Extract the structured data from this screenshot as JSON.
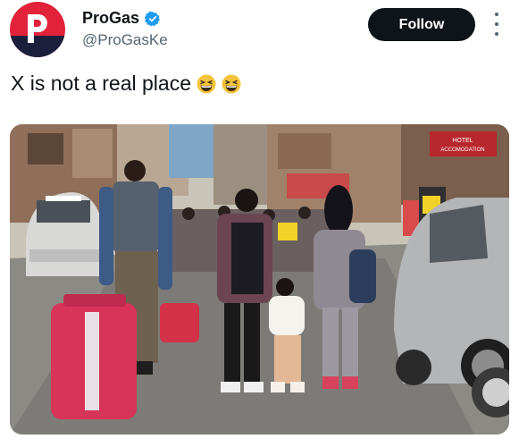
{
  "tweet": {
    "author": {
      "display_name": "ProGas",
      "handle": "@ProGasKe",
      "avatar_letter": "P",
      "verified": true,
      "brand_colors": {
        "red": "#e2223a",
        "navy": "#1c1f3b",
        "verified_blue": "#1d9bf0"
      }
    },
    "follow_label": "Follow",
    "text": "X is not a real place",
    "emojis": [
      "grinning-squinting-face",
      "grinning-squinting-face"
    ],
    "media": {
      "signs": [
        "HOTEL",
        "ACCOMODATION"
      ]
    }
  }
}
